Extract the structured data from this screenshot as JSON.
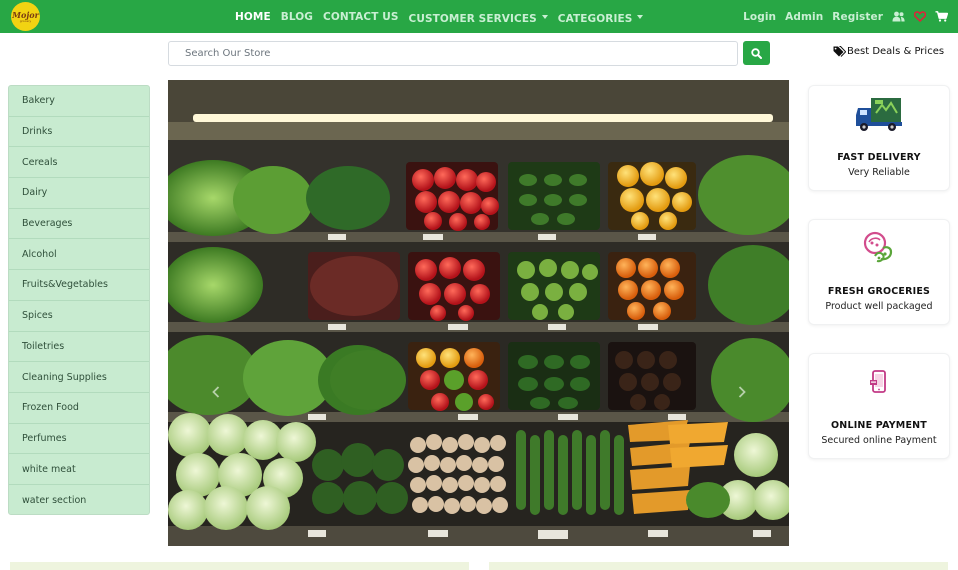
{
  "brand": {
    "logo_text": "Mojor",
    "logo_sub": "grocery"
  },
  "nav": {
    "links": [
      {
        "label": "HOME",
        "active": true
      },
      {
        "label": "BLOG"
      },
      {
        "label": "CONTACT US"
      },
      {
        "label": "CUSTOMER SERVICES",
        "dropdown": true
      },
      {
        "label": "CATEGORIES",
        "dropdown": true
      }
    ],
    "right": [
      {
        "label": "Login"
      },
      {
        "label": "Admin"
      },
      {
        "label": "Register"
      }
    ],
    "icons": [
      "users-icon",
      "heart-icon",
      "cart-icon"
    ]
  },
  "search": {
    "placeholder": "Search Our Store",
    "value": ""
  },
  "deals_label": "Best Deals & Prices",
  "categories": [
    "Bakery",
    "Drinks",
    "Cereals",
    "Dairy",
    "Beverages",
    "Alcohol",
    "Fruits&Vegetables",
    "Spices",
    "Toiletries",
    "Cleaning Supplies",
    "Frozen Food",
    "Perfumes",
    "white meat",
    "water section"
  ],
  "features": [
    {
      "title": "FAST DELIVERY",
      "subtitle": "Very Reliable",
      "icon": "delivery-truck-icon"
    },
    {
      "title": "FRESH GROCERIES",
      "subtitle": "Product well packaged",
      "icon": "fresh-groceries-icon"
    },
    {
      "title": "ONLINE PAYMENT",
      "subtitle": "Secured online Payment",
      "icon": "phone-payment-icon"
    }
  ],
  "colors": {
    "primary": "#28a745",
    "sidebar_bg": "#c8ebd0",
    "heart": "#e0213a"
  }
}
